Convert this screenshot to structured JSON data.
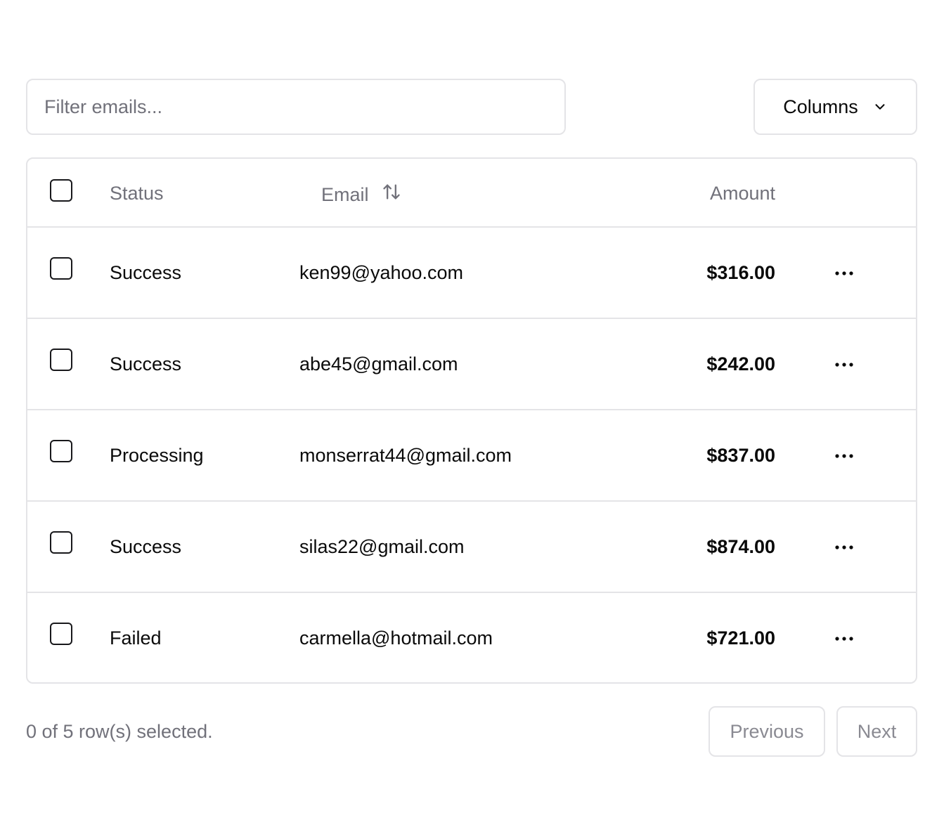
{
  "filter": {
    "placeholder": "Filter emails...",
    "value": ""
  },
  "columns_button": {
    "label": "Columns",
    "icon": "chevron-down-icon"
  },
  "table": {
    "headers": {
      "status": "Status",
      "email": "Email",
      "amount": "Amount"
    },
    "sort_icon": "arrow-up-down-icon",
    "rows": [
      {
        "status": "Success",
        "email": "ken99@yahoo.com",
        "amount": "$316.00",
        "checked": false
      },
      {
        "status": "Success",
        "email": "abe45@gmail.com",
        "amount": "$242.00",
        "checked": false
      },
      {
        "status": "Processing",
        "email": "monserrat44@gmail.com",
        "amount": "$837.00",
        "checked": false
      },
      {
        "status": "Success",
        "email": "silas22@gmail.com",
        "amount": "$874.00",
        "checked": false
      },
      {
        "status": "Failed",
        "email": "carmella@hotmail.com",
        "amount": "$721.00",
        "checked": false
      }
    ],
    "row_action_icon": "more-horizontal-icon"
  },
  "footer": {
    "selection_text": "0 of 5 row(s) selected.",
    "previous_label": "Previous",
    "next_label": "Next"
  },
  "colors": {
    "border": "#e4e4e7",
    "muted_text": "#71717a",
    "text": "#0a0a0a"
  }
}
